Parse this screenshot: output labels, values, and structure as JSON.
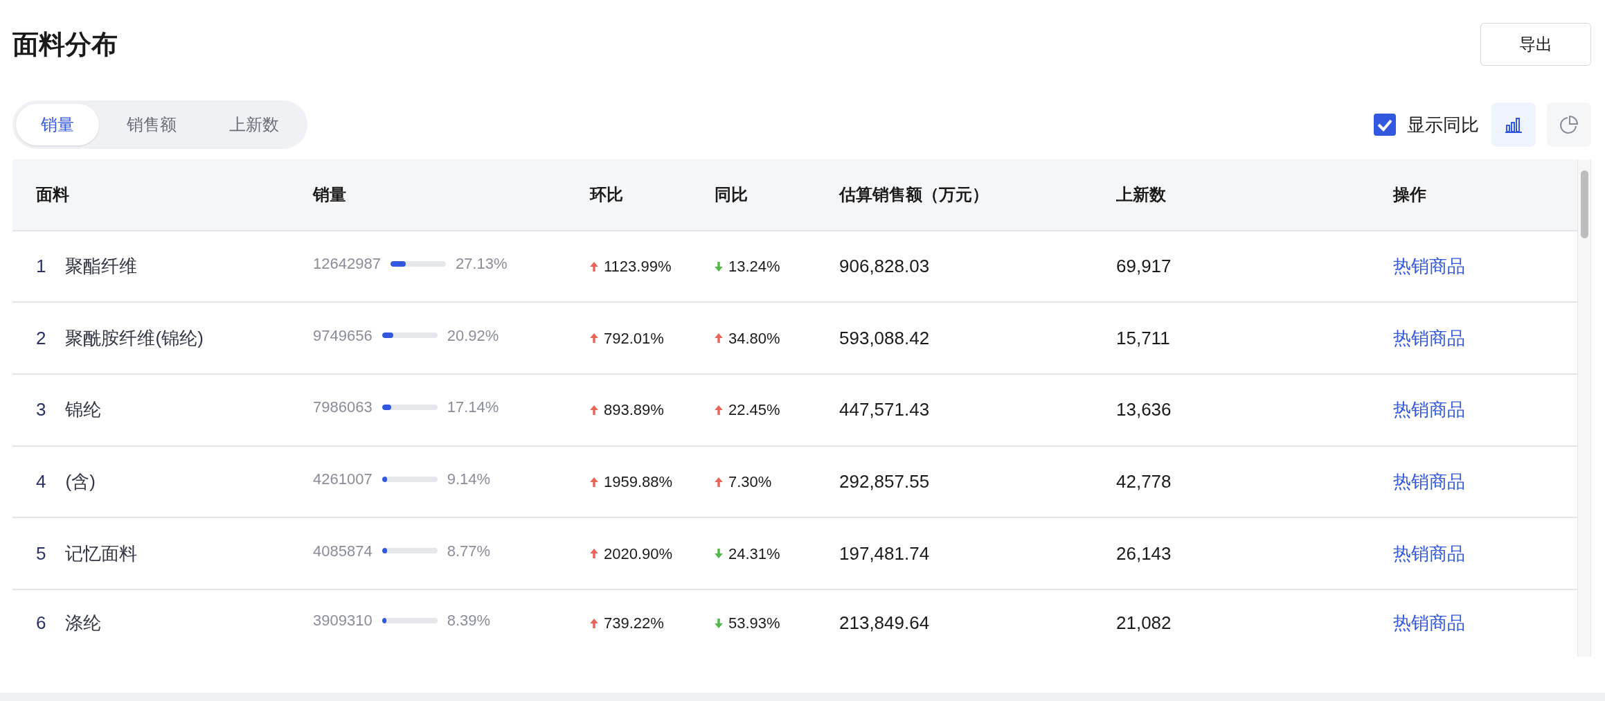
{
  "title": "面料分布",
  "export_button": "导出",
  "tabs": [
    {
      "label": "销量",
      "selected": true
    },
    {
      "label": "销售额",
      "selected": false
    },
    {
      "label": "上新数",
      "selected": false
    }
  ],
  "show_yoy": {
    "label": "显示同比",
    "checked": true
  },
  "view_toggle": [
    {
      "kind": "bar",
      "selected": true
    },
    {
      "kind": "pie",
      "selected": false
    }
  ],
  "table": {
    "columns": [
      "面料",
      "销量",
      "环比",
      "同比",
      "估算销售额（万元）",
      "上新数",
      "操作"
    ],
    "rows": [
      {
        "index": "1",
        "name": "聚酯纤维",
        "sales": "12642987",
        "level": 0.2713,
        "share": "27.13%",
        "mom": {
          "kind": "up",
          "value": "1123.99%"
        },
        "yoy": {
          "kind": "down",
          "value": "13.24%"
        },
        "amount": "906,828.03",
        "new_count": "69,917",
        "action": "热销商品"
      },
      {
        "index": "2",
        "name": "聚酰胺纤维(锦纶)",
        "sales": "9749656",
        "level": 0.2092,
        "share": "20.92%",
        "mom": {
          "kind": "up",
          "value": "792.01%"
        },
        "yoy": {
          "kind": "up",
          "value": "34.80%"
        },
        "amount": "593,088.42",
        "new_count": "15,711",
        "action": "热销商品"
      },
      {
        "index": "3",
        "name": "锦纶",
        "sales": "7986063",
        "level": 0.1714,
        "share": "17.14%",
        "mom": {
          "kind": "up",
          "value": "893.89%"
        },
        "yoy": {
          "kind": "up",
          "value": "22.45%"
        },
        "amount": "447,571.43",
        "new_count": "13,636",
        "action": "热销商品"
      },
      {
        "index": "4",
        "name": "(含)",
        "sales": "4261007",
        "level": 0.0914,
        "share": "9.14%",
        "mom": {
          "kind": "up",
          "value": "1959.88%"
        },
        "yoy": {
          "kind": "up",
          "value": "7.30%"
        },
        "amount": "292,857.55",
        "new_count": "42,778",
        "action": "热销商品"
      },
      {
        "index": "5",
        "name": "记忆面料",
        "sales": "4085874",
        "level": 0.0877,
        "share": "8.77%",
        "mom": {
          "kind": "up",
          "value": "2020.90%"
        },
        "yoy": {
          "kind": "down",
          "value": "24.31%"
        },
        "amount": "197,481.74",
        "new_count": "26,143",
        "action": "热销商品"
      },
      {
        "index": "6",
        "name": "涤纶",
        "sales": "3909310",
        "level": 0.0839,
        "share": "8.39%",
        "mom": {
          "kind": "up",
          "value": "739.22%"
        },
        "yoy": {
          "kind": "down",
          "value": "53.93%"
        },
        "amount": "213,849.64",
        "new_count": "21,082",
        "action": "热销商品"
      }
    ]
  }
}
